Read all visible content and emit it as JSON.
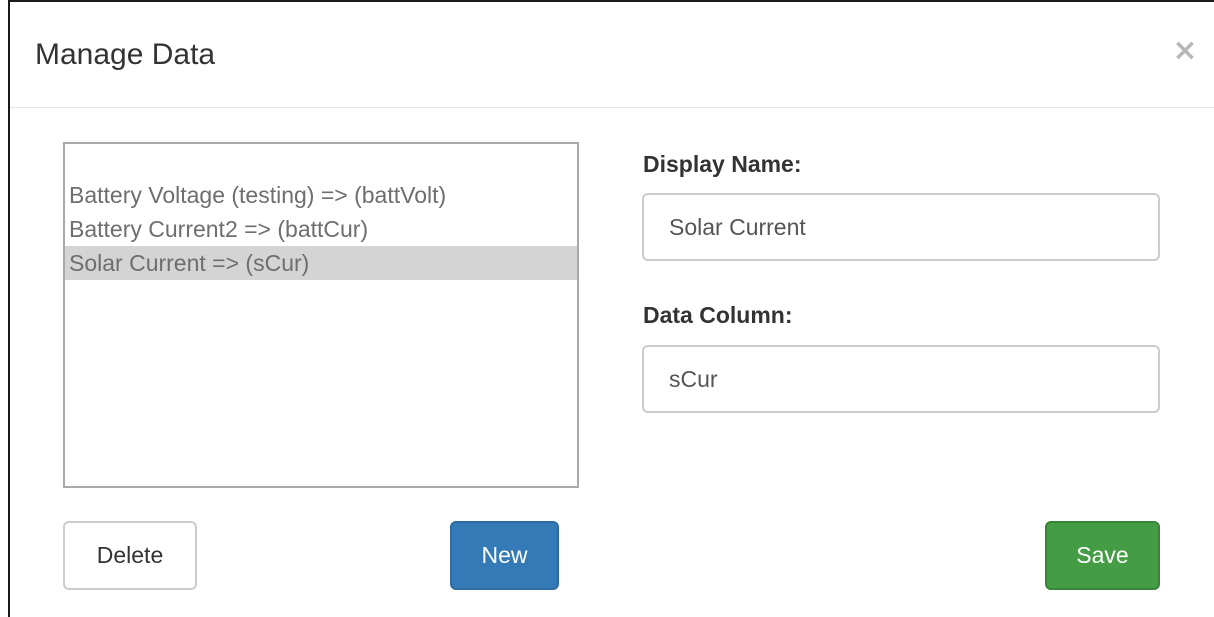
{
  "dialog": {
    "title": "Manage Data",
    "close_glyph": "×"
  },
  "list": {
    "items": [
      {
        "label": "Battery Voltage (testing) => (battVolt)",
        "selected": false
      },
      {
        "label": "Battery Current2 => (battCur)",
        "selected": false
      },
      {
        "label": "Solar Current => (sCur)",
        "selected": true
      }
    ]
  },
  "form": {
    "display_name_label": "Display Name:",
    "display_name_value": "Solar Current",
    "data_column_label": "Data Column:",
    "data_column_value": "sCur"
  },
  "buttons": {
    "delete_label": "Delete",
    "new_label": "New",
    "save_label": "Save"
  },
  "colors": {
    "primary": "#337ab7",
    "success": "#449d44",
    "selection": "#d4d4d4"
  },
  "icons": {
    "close": "close-icon"
  }
}
